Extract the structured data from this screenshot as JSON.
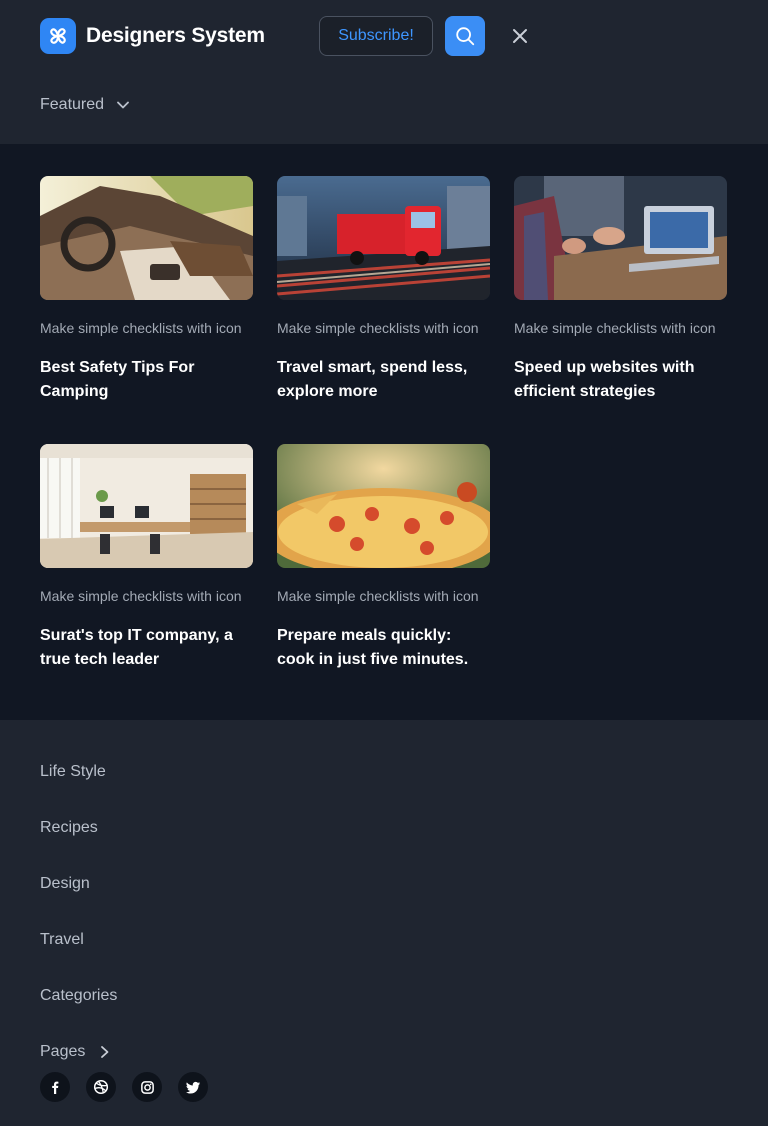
{
  "brand": {
    "name": "Designers System",
    "logo_icon": "pinwheel-logo-icon",
    "accent": "#2f86f4"
  },
  "header": {
    "subscribe_label": "Subscribe!",
    "search_icon": "search-icon",
    "close_icon": "close-icon"
  },
  "featured": {
    "label": "Featured",
    "icon": "chevron-down-icon"
  },
  "cards": [
    {
      "subtitle": "Make simple checklists with icon",
      "title": "Best Safety Tips For Camping",
      "image": "car-interior"
    },
    {
      "subtitle": "Make simple checklists with icon",
      "title": "Travel smart, spend less, explore more",
      "image": "red-truck"
    },
    {
      "subtitle": "Make simple checklists with icon",
      "title": "Speed up websites with efficient strategies",
      "image": "laptop-meeting"
    },
    {
      "subtitle": "Make simple checklists with icon",
      "title": "Surat's top IT company, a true tech leader",
      "image": "modern-office"
    },
    {
      "subtitle": "Make simple checklists with icon",
      "title": "Prepare meals quickly: cook in just five minutes.",
      "image": "pizza"
    }
  ],
  "menu": {
    "items": [
      {
        "label": "Life Style"
      },
      {
        "label": "Recipes"
      },
      {
        "label": "Design"
      },
      {
        "label": "Travel"
      },
      {
        "label": "Categories"
      },
      {
        "label": "Pages",
        "icon": "chevron-right-icon"
      }
    ]
  },
  "socials": [
    "facebook-icon",
    "dribbble-icon",
    "instagram-icon",
    "twitter-icon"
  ],
  "colors": {
    "header_bg": "#1f2530",
    "panel_bg": "#111723",
    "primary": "#3b8ef5"
  }
}
